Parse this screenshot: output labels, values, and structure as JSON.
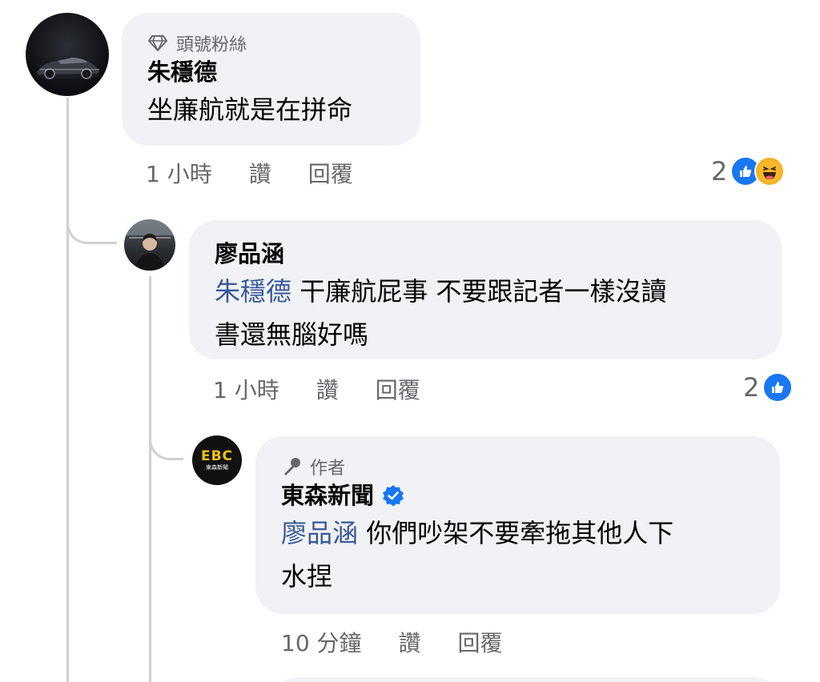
{
  "comments": [
    {
      "badge_label": "頭號粉絲",
      "badge_icon": "diamond-icon",
      "author": "朱穩德",
      "text": "坐廉航就是在拼命",
      "time": "1 小時",
      "like_label": "讚",
      "reply_label": "回覆",
      "reaction_count": "2",
      "reaction_icons": [
        "like-icon",
        "haha-icon"
      ]
    },
    {
      "author": "廖品涵",
      "mention": "朱穩德",
      "text_line1": " 干廉航屁事 不要跟記者一樣沒讀",
      "text_line2": "書還無腦好嗎",
      "time": "1 小時",
      "like_label": "讚",
      "reply_label": "回覆",
      "reaction_count": "2",
      "reaction_icons": [
        "like-icon"
      ]
    },
    {
      "badge_label": "作者",
      "badge_icon": "microphone-icon",
      "author": "東森新聞",
      "verified_icon": "verified-badge-icon",
      "avatar_text_top": "EBC",
      "avatar_text_bottom": "東森新聞",
      "mention": "廖品涵",
      "text_line1": " 你們吵架不要牽拖其他人下",
      "text_line2": "水捏",
      "time": "10 分鐘",
      "like_label": "讚",
      "reply_label": "回覆"
    }
  ],
  "colors": {
    "bubble": "#f0f2f5",
    "meta_text": "#65676b",
    "mention": "#385898",
    "like_blue": "#1877f2",
    "thread_line": "#ced0d4"
  }
}
